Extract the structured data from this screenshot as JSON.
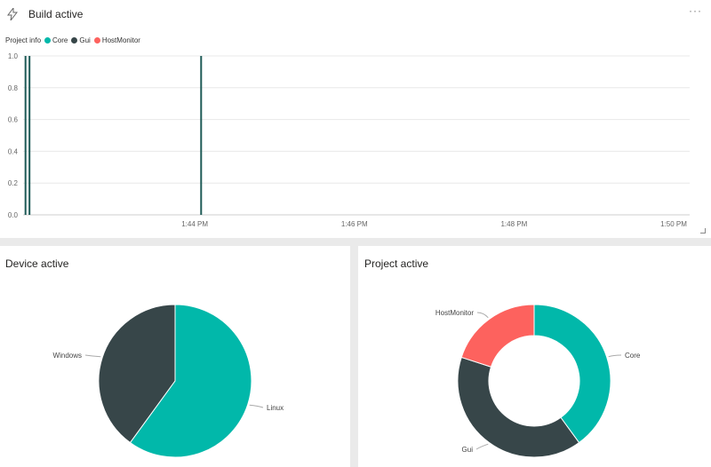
{
  "build_tile": {
    "title": "Build active",
    "menu": "···",
    "legend_title": "Project info",
    "legend": [
      {
        "name": "Core",
        "color": "#01b8aa"
      },
      {
        "name": "Gui",
        "color": "#374649"
      },
      {
        "name": "HostMonitor",
        "color": "#fd625e"
      }
    ],
    "icon": "lightning-bolt-icon"
  },
  "device_tile": {
    "title": "Device active"
  },
  "project_tile": {
    "title": "Project active"
  },
  "chart_data": [
    {
      "type": "bar",
      "title": "Build active",
      "legend_title": "Project info",
      "legend_placement": "top-left",
      "grid": true,
      "xlabel": "",
      "ylabel": "",
      "ylim": [
        0,
        1
      ],
      "y_ticks": [
        "0.0",
        "0.2",
        "0.4",
        "0.6",
        "0.8",
        "1.0"
      ],
      "x_ticks": [
        "1:44 PM",
        "1:46 PM",
        "1:48 PM",
        "1:50 PM"
      ],
      "x_tick_minutes": [
        104,
        106,
        108,
        110
      ],
      "x_range_minutes": [
        101.85,
        110.2
      ],
      "series": [
        {
          "name": "Gui",
          "color": "#374649",
          "x_minutes": [
            101.88,
            101.93,
            104.08
          ],
          "values": [
            1,
            1,
            1
          ]
        }
      ]
    },
    {
      "type": "pie",
      "title": "Device active",
      "slices": [
        {
          "label": "Linux",
          "value": 60,
          "color": "#01b8aa"
        },
        {
          "label": "Windows",
          "value": 40,
          "color": "#374649"
        }
      ]
    },
    {
      "type": "pie",
      "title": "Project active",
      "donut": true,
      "slices": [
        {
          "label": "Core",
          "value": 40,
          "color": "#01b8aa"
        },
        {
          "label": "Gui",
          "value": 40,
          "color": "#374649"
        },
        {
          "label": "HostMonitor",
          "value": 20,
          "color": "#fd625e"
        }
      ]
    }
  ]
}
